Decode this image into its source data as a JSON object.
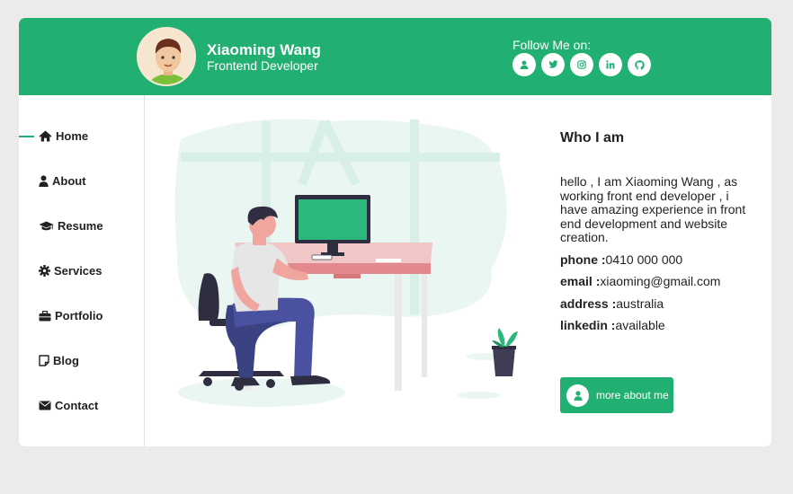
{
  "header": {
    "name": "Xiaoming Wang",
    "role": "Frontend Developer",
    "follow_label": "Follow Me on:",
    "socials": [
      "user-icon",
      "twitter-icon",
      "instagram-icon",
      "linkedin-icon",
      "github-icon"
    ]
  },
  "nav": {
    "items": [
      {
        "label": "Home",
        "icon": "home-icon",
        "active": true
      },
      {
        "label": "About",
        "icon": "user-icon"
      },
      {
        "label": "Resume",
        "icon": "graduation-cap-icon"
      },
      {
        "label": "Services",
        "icon": "gear-icon"
      },
      {
        "label": "Portfolio",
        "icon": "briefcase-icon"
      },
      {
        "label": "Blog",
        "icon": "note-icon"
      },
      {
        "label": "Contact",
        "icon": "envelope-icon"
      }
    ]
  },
  "about": {
    "heading": "Who I am",
    "intro": "hello , I am Xiaoming Wang , as working front end developer , i have amazing experience in front end development and website creation.",
    "phone_label": "phone :",
    "phone": "0410 000 000",
    "email_label": "email :",
    "email": "xiaoming@gmail.com",
    "address_label": "address :",
    "address": "australia",
    "linkedin_label": "linkedin :",
    "linkedin": "available",
    "more_button": "more about me"
  },
  "colors": {
    "accent": "#22b072",
    "background": "#ebebeb"
  }
}
